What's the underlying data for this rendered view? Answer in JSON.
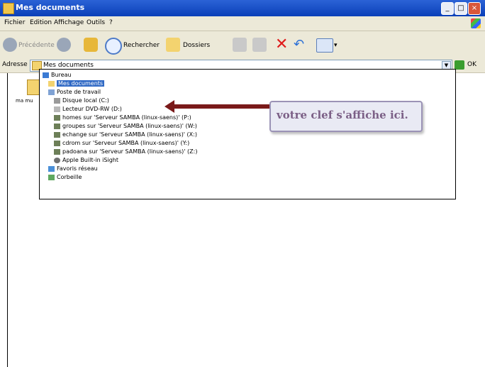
{
  "window": {
    "title": "Mes documents",
    "buttons": [
      "_",
      "□",
      "×"
    ]
  },
  "menubar": {
    "items": [
      "Fichier",
      "Edition",
      "Affichage",
      "Outils",
      "?"
    ]
  },
  "toolbar": {
    "back": "Précédente",
    "search": "Rechercher",
    "folders": "Dossiers"
  },
  "addressbar": {
    "label": "Adresse",
    "value": "Mes documents",
    "go_label": "OK"
  },
  "sidebar": {
    "label": "ma mu"
  },
  "dropdown": {
    "items": [
      {
        "label": "Bureau",
        "icon": "desktop-icon"
      },
      {
        "label": "Mes documents",
        "icon": "documents-folder-icon",
        "selected": true
      },
      {
        "label": "Poste de travail",
        "icon": "computer-icon"
      },
      {
        "label": "Disque local (C:)",
        "icon": "hard-disk-icon"
      },
      {
        "label": "Lecteur DVD-RW (D:)",
        "icon": "dvd-drive-icon"
      },
      {
        "label": "homes sur 'Serveur SAMBA (linux-saens)' (P:)",
        "icon": "network-drive-icon"
      },
      {
        "label": "groupes sur 'Serveur SAMBA (linux-saens)' (W:)",
        "icon": "network-drive-icon"
      },
      {
        "label": "echange sur 'Serveur SAMBA (linux-saens)' (X:)",
        "icon": "network-drive-icon"
      },
      {
        "label": "cdrom sur 'Serveur SAMBA (linux-saens)' (Y:)",
        "icon": "network-drive-icon"
      },
      {
        "label": "padoana sur 'Serveur SAMBA (linux-saens)' (Z:)",
        "icon": "network-drive-icon"
      },
      {
        "label": "Apple Built-in iSight",
        "icon": "camera-icon"
      },
      {
        "label": "Favoris réseau",
        "icon": "network-places-icon"
      },
      {
        "label": "Corbeille",
        "icon": "recycle-bin-icon"
      }
    ]
  },
  "annotation": {
    "text": "votre clef s'affiche ici."
  }
}
